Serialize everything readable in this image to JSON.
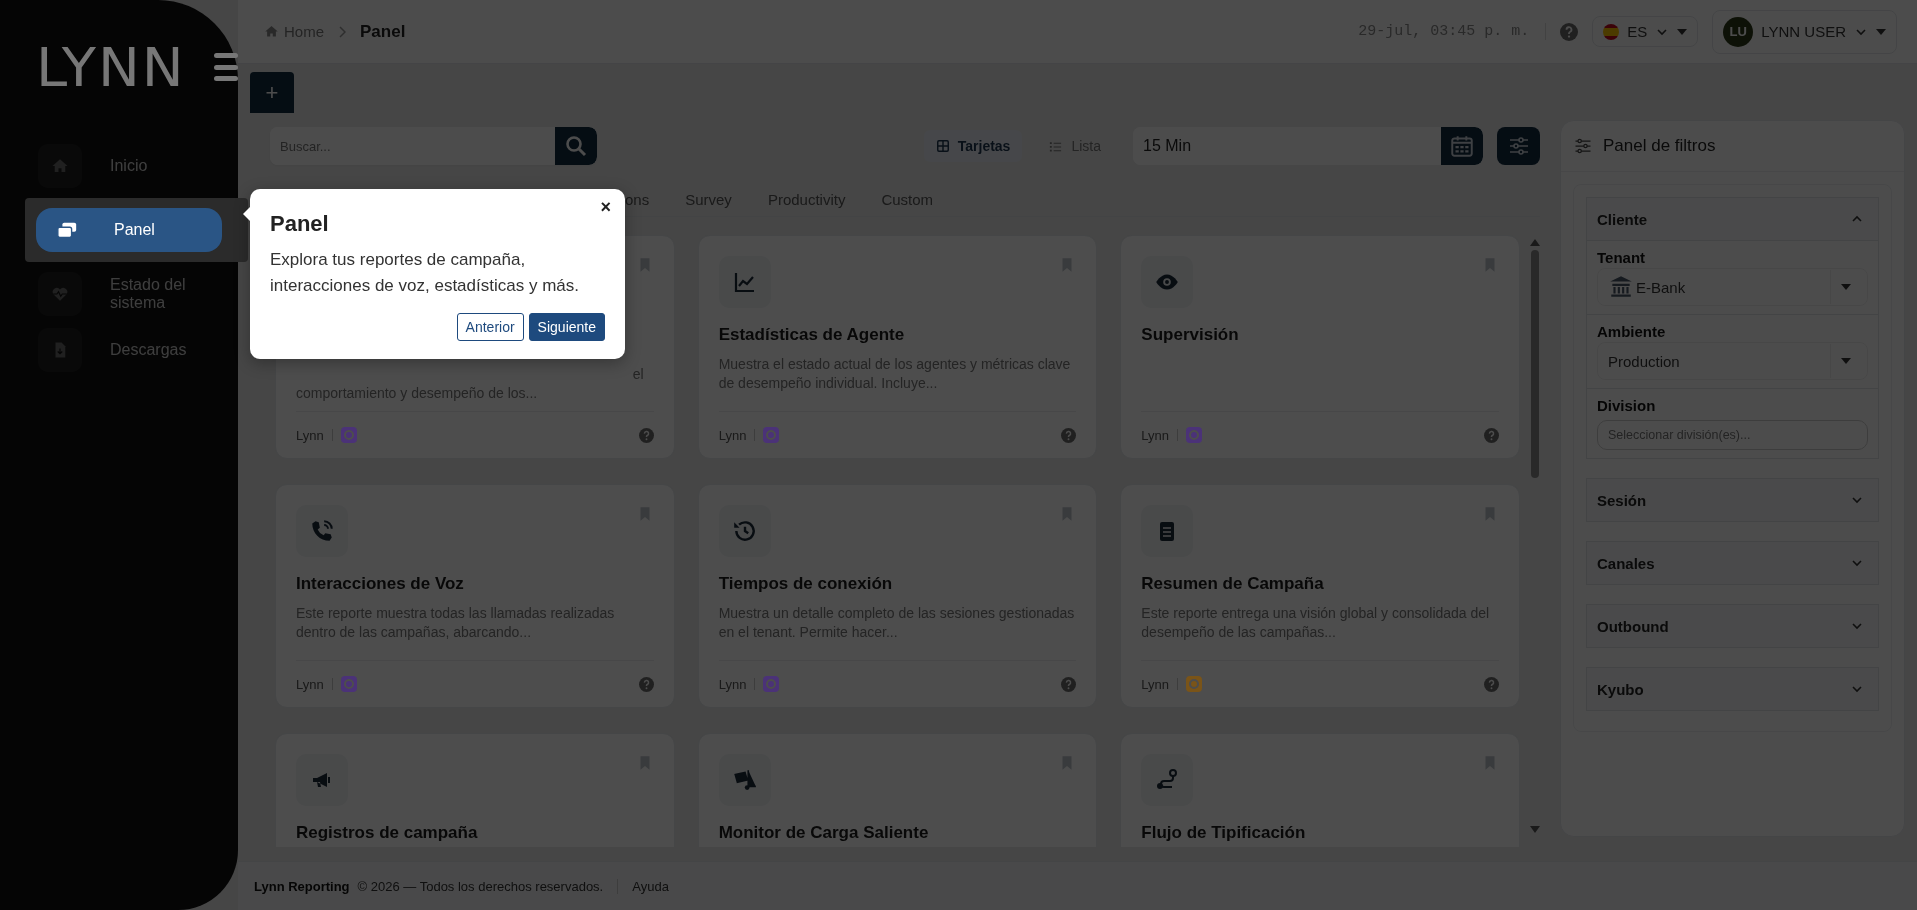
{
  "sidebar": {
    "logo": "LYNN",
    "items": [
      {
        "label": "Inicio",
        "kind": "home",
        "selected": false
      },
      {
        "label": "Panel",
        "kind": "cards",
        "selected": true
      },
      {
        "label": "Estado del sistema",
        "kind": "heart",
        "selected": false
      },
      {
        "label": "Descargas",
        "kind": "download",
        "selected": false
      }
    ]
  },
  "topbar": {
    "breadcrumb": [
      "Home",
      "Panel"
    ],
    "datetime": "29-jul, 03:45 p. m.",
    "language": "ES",
    "user": {
      "initials": "LU",
      "name": "LYNN USER"
    }
  },
  "toolbar": {
    "add_button": "+",
    "search": {
      "placeholder": "Buscar..."
    },
    "views": [
      {
        "label": "Tarjetas",
        "kind": "grid",
        "selected": true
      },
      {
        "label": "Lista",
        "kind": "list",
        "selected": false
      }
    ],
    "interval": {
      "value": "15 Min"
    }
  },
  "tabs": [
    "ons",
    "Survey",
    "Productivity",
    "Custom"
  ],
  "covered_card": {
    "description_tail": "el",
    "description": "comportamiento y desempeño de los...",
    "source": "Lynn",
    "color": "#4b3278"
  },
  "cards": [
    {
      "kind": "chart",
      "title": "Estadísticas de Agente",
      "description": "Muestra el estado actual de los agentes y métricas clave de desempeño individual. Incluye...",
      "source": "Lynn",
      "color": "#4b3278"
    },
    {
      "kind": "eye",
      "title": "Supervisión",
      "source": "Lynn",
      "color": "#4b3278"
    },
    {
      "kind": "phone",
      "title": "Interacciones de Voz",
      "description": "Este reporte muestra todas las llamadas realizadas dentro de las campañas, abarcando...",
      "source": "Lynn",
      "color": "#4b3278"
    },
    {
      "kind": "history",
      "title": "Tiempos de conexión",
      "description": "Muestra un detalle completo de las sesiones gestionadas en el tenant. Permite hacer...",
      "source": "Lynn",
      "color": "#4b3278"
    },
    {
      "kind": "clipboard",
      "title": "Resumen de Campaña",
      "description": "Este reporte entrega una visión global y consolidada del desempeño de las campañas...",
      "source": "Lynn",
      "color": "#7a5418"
    },
    {
      "kind": "megaphone",
      "title": "Registros de campaña"
    },
    {
      "kind": "truck",
      "title": "Monitor de Carga Saliente"
    },
    {
      "kind": "route",
      "title": "Flujo de Tipificación"
    }
  ],
  "filters": {
    "title": "Panel de filtros",
    "sections": [
      {
        "label": "Cliente",
        "expanded": true,
        "fields": [
          {
            "label": "Tenant",
            "kind": "select",
            "value": "E-Bank",
            "logo": true
          },
          {
            "label": "Ambiente",
            "kind": "select",
            "value": "Production",
            "logo": false
          },
          {
            "label": "Division",
            "kind": "input",
            "placeholder": "Seleccionar división(es)..."
          }
        ]
      },
      {
        "label": "Sesión",
        "expanded": false
      },
      {
        "label": "Canales",
        "expanded": false
      },
      {
        "label": "Outbound",
        "expanded": false
      },
      {
        "label": "Kyubo",
        "expanded": false
      }
    ]
  },
  "tour": {
    "title": "Panel",
    "text": "Explora tus reportes de campaña, interacciones de voz, estadísticas y más.",
    "close": "×",
    "buttons": [
      {
        "label": "Anterior",
        "kind": "secondary"
      },
      {
        "label": "Siguiente",
        "kind": "primary"
      }
    ]
  },
  "footer": {
    "brand": "Lynn Reporting",
    "copyright": "© 2026 — Todos los derechos reservados.",
    "links": [
      "Ayuda"
    ]
  }
}
